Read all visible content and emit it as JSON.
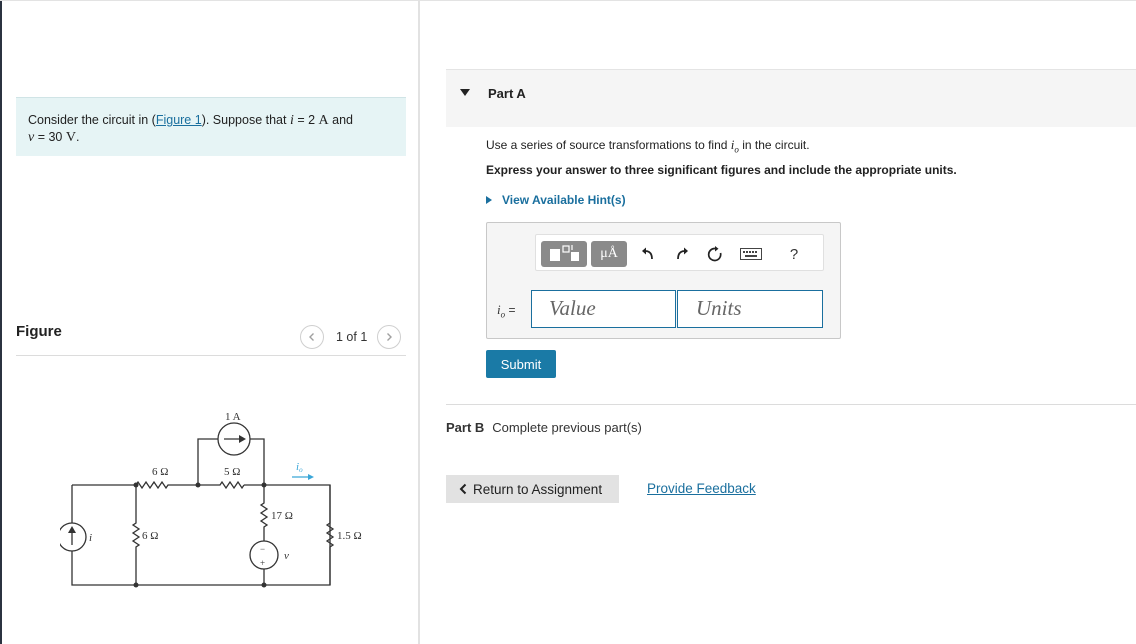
{
  "problem": {
    "text_before_link": "Consider the circuit in (",
    "figure_link": "Figure 1",
    "text_after_link": "). Suppose that ",
    "i_var": "i",
    "i_eq": " = 2 ",
    "i_unit": "A",
    "and": " and",
    "v_var": "v",
    "v_eq": " = 30 ",
    "v_unit": "V",
    "period": "."
  },
  "figure": {
    "title": "Figure",
    "pager_text": "1 of 1",
    "prev_icon": "chevron-left-icon",
    "next_icon": "chevron-right-icon"
  },
  "circuit_labels": {
    "current_source_top": "1 A",
    "r_left_top": "6 Ω",
    "r_mid_top": "5 Ω",
    "io_label": "i",
    "io_sub": "o",
    "r_mid_vert": "17 Ω",
    "r_left_vert": "6 Ω",
    "r_right_vert": "1.5 Ω",
    "source_i": "i",
    "source_v": "v",
    "plus": "+",
    "minus": "−"
  },
  "partA": {
    "title": "Part A",
    "instr1_pre": "Use a series of source transformations to find ",
    "instr1_var": "i",
    "instr1_sub": "o",
    "instr1_post": " in the circuit.",
    "instr2": "Express your answer to three significant figures and include the appropriate units.",
    "hint": "View Available Hint(s)",
    "toolbar": {
      "units_button": "μÅ",
      "help": "?",
      "icons": [
        "templates-icon",
        "units-icon",
        "undo-icon",
        "redo-icon",
        "reset-icon",
        "keyboard-icon",
        "help-icon"
      ]
    },
    "answer_label_var": "i",
    "answer_label_sub": "o",
    "answer_label_eq": " =",
    "value_placeholder": "Value",
    "units_placeholder": "Units",
    "submit": "Submit"
  },
  "partB": {
    "title": "Part B",
    "status": "Complete previous part(s)"
  },
  "footer": {
    "return": "Return to Assignment",
    "feedback": "Provide Feedback"
  },
  "colors": {
    "link": "#1a6f9e",
    "submit_bg": "#1a7aa6",
    "problem_bg": "#e6f4f5",
    "io_arrow": "#3aa6d8"
  }
}
